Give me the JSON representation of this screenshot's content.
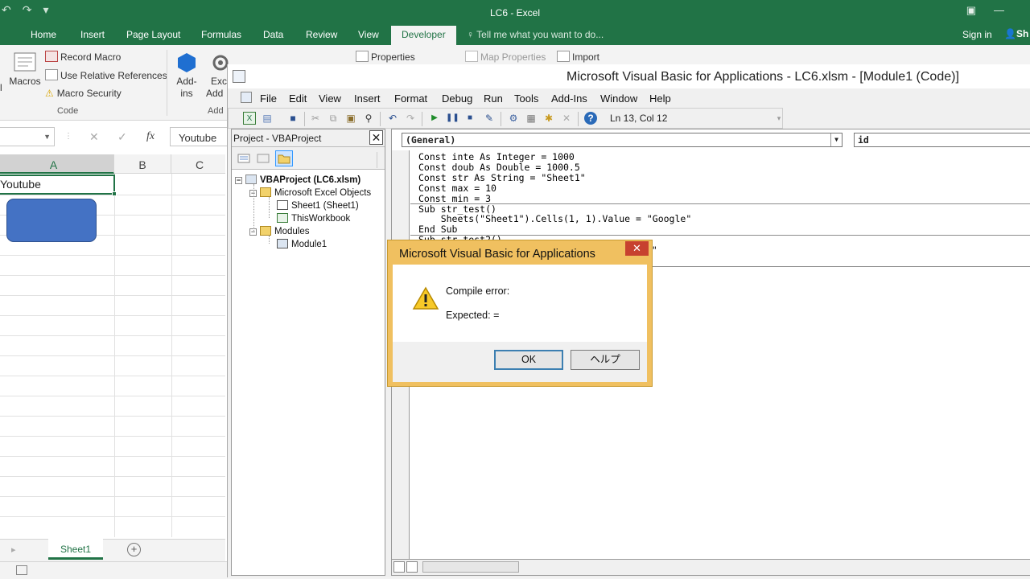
{
  "excel": {
    "title": "LC6 - Excel",
    "tabs": [
      "Home",
      "Insert",
      "Page Layout",
      "Formulas",
      "Data",
      "Review",
      "View",
      "Developer"
    ],
    "active_tab": "Developer",
    "tell_me": "Tell me what you want to do...",
    "sign_in": "Sign in",
    "share": "Sh",
    "ribbon": {
      "macros": "Macros",
      "record_macro": "Record Macro",
      "use_relative": "Use Relative References",
      "macro_security": "Macro Security",
      "code_group": "Code",
      "add_ins_line1": "Add-",
      "add_ins_line2": "ins",
      "excel_add_ins_line1": "Exc",
      "excel_add_ins_line2": "Add",
      "add_group": "Add",
      "properties": "Properties",
      "map_properties": "Map Properties",
      "import": "Import"
    },
    "formula_bar": {
      "cancel": "✕",
      "enter": "✓",
      "fx": "fx",
      "value": "Youtube"
    },
    "columns": [
      "A",
      "B",
      "C"
    ],
    "cell_a1": "Youtube",
    "sheet_tab": "Sheet1"
  },
  "vbe": {
    "title": "Microsoft Visual Basic for Applications - LC6.xlsm - [Module1 (Code)]",
    "menu": [
      "File",
      "Edit",
      "View",
      "Insert",
      "Format",
      "Debug",
      "Run",
      "Tools",
      "Add-Ins",
      "Window",
      "Help"
    ],
    "position": "Ln 13, Col 12",
    "project_title": "Project - VBAProject",
    "tree": {
      "root": "VBAProject (LC6.xlsm)",
      "excel_objects": "Microsoft Excel Objects",
      "sheet1": "Sheet1 (Sheet1)",
      "thisworkbook": "ThisWorkbook",
      "modules": "Modules",
      "module1": "Module1"
    },
    "object_combo": "(General)",
    "proc_combo": "id",
    "code": {
      "line1": "Const inte As Integer = 1000",
      "line2": "Const doub As Double = 1000.5",
      "line3": "Const str As String = \"Sheet1\"",
      "line4": "Const max = 10",
      "line5": "Const min = 3",
      "line6": "Sub str_test()",
      "line7": "    Sheets(\"Sheet1\").Cells(1, 1).Value = \"Google\"",
      "line8": "End Sub",
      "line9": "Sub str_test2()",
      "line10": "be\""
    }
  },
  "dialog": {
    "title": "Microsoft Visual Basic for Applications",
    "close": "✕",
    "message": "Compile error:",
    "detail": "Expected: =",
    "ok": "OK",
    "help": "ヘルプ"
  }
}
